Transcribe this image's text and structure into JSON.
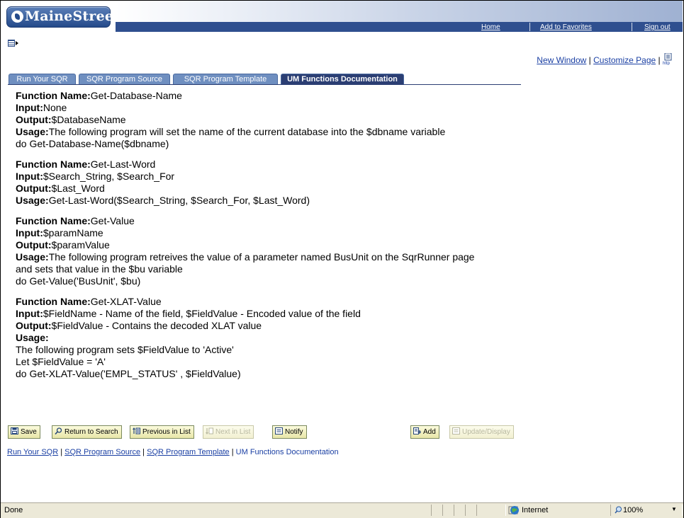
{
  "header": {
    "logo_text": "MaineStreet",
    "links": [
      "Home",
      "Add to Favorites",
      "Sign out"
    ]
  },
  "page_actions": {
    "new_window": "New Window",
    "separator": "|",
    "customize_page": "Customize Page",
    "http_icon_text": "http"
  },
  "tabs": [
    {
      "label": "Run Your SQR",
      "active": false
    },
    {
      "label": "SQR Program Source",
      "active": false
    },
    {
      "label": "SQR Program Template",
      "active": false
    },
    {
      "label": "UM Functions Documentation",
      "active": true
    }
  ],
  "functions": [
    {
      "name_label": "Function Name:",
      "name": "Get-Database-Name",
      "input_label": "Input:",
      "input": "None",
      "output_label": "Output:",
      "output": "$DatabaseName",
      "usage_label": "Usage:",
      "usage": "The following program will set the name of the current database into the $dbname variable",
      "code": "do Get-Database-Name($dbname)"
    },
    {
      "name_label": "Function Name:",
      "name": "Get-Last-Word",
      "input_label": "Input:",
      "input": "$Search_String, $Search_For",
      "output_label": "Output:",
      "output": "$Last_Word",
      "usage_label": "Usage:",
      "usage": "Get-Last-Word($Search_String, $Search_For, $Last_Word)"
    },
    {
      "name_label": "Function Name:",
      "name": "Get-Value",
      "input_label": "Input:",
      "input": "$paramName",
      "output_label": "Output:",
      "output": "$paramValue",
      "usage_label": "Usage:",
      "usage": "The following program retreives the value of a parameter named BusUnit on the SqrRunner page",
      "usage_line2": "and sets that value in the $bu variable",
      "code": "do Get-Value('BusUnit', $bu)"
    },
    {
      "name_label": "Function Name:",
      "name": "Get-XLAT-Value",
      "input_label": "Input:",
      "input": "$FieldName - Name of the field, $FieldValue - Encoded value of the field",
      "output_label": "Output:",
      "output": "$FieldValue - Contains the decoded XLAT value",
      "usage_label": "Usage:",
      "usage_line1": "The following program sets $FieldValue to 'Active'",
      "usage_line2": "Let $FieldValue = 'A'",
      "code": "do Get-XLAT-Value('EMPL_STATUS' , $FieldValue)"
    }
  ],
  "toolbar": {
    "save": "Save",
    "return_to_search": "Return to Search",
    "previous_in_list": "Previous in List",
    "next_in_list": "Next in List",
    "notify": "Notify",
    "add": "Add",
    "update_display": "Update/Display"
  },
  "bottom_links": {
    "run_your_sqr": "Run Your SQR",
    "sqr_program_source": "SQR Program Source",
    "sqr_program_template": "SQR Program Template",
    "um_functions_documentation": "UM Functions Documentation",
    "separator": " | "
  },
  "statusbar": {
    "status": "Done",
    "zone": "Internet",
    "zoom": "100%"
  },
  "colors": {
    "header_stripe": "#2f4f8f",
    "tab_inactive": "#6f8fc0",
    "tab_active": "#2b3e73",
    "link": "#1a3fa3",
    "button_face": "#f0eeb8"
  }
}
